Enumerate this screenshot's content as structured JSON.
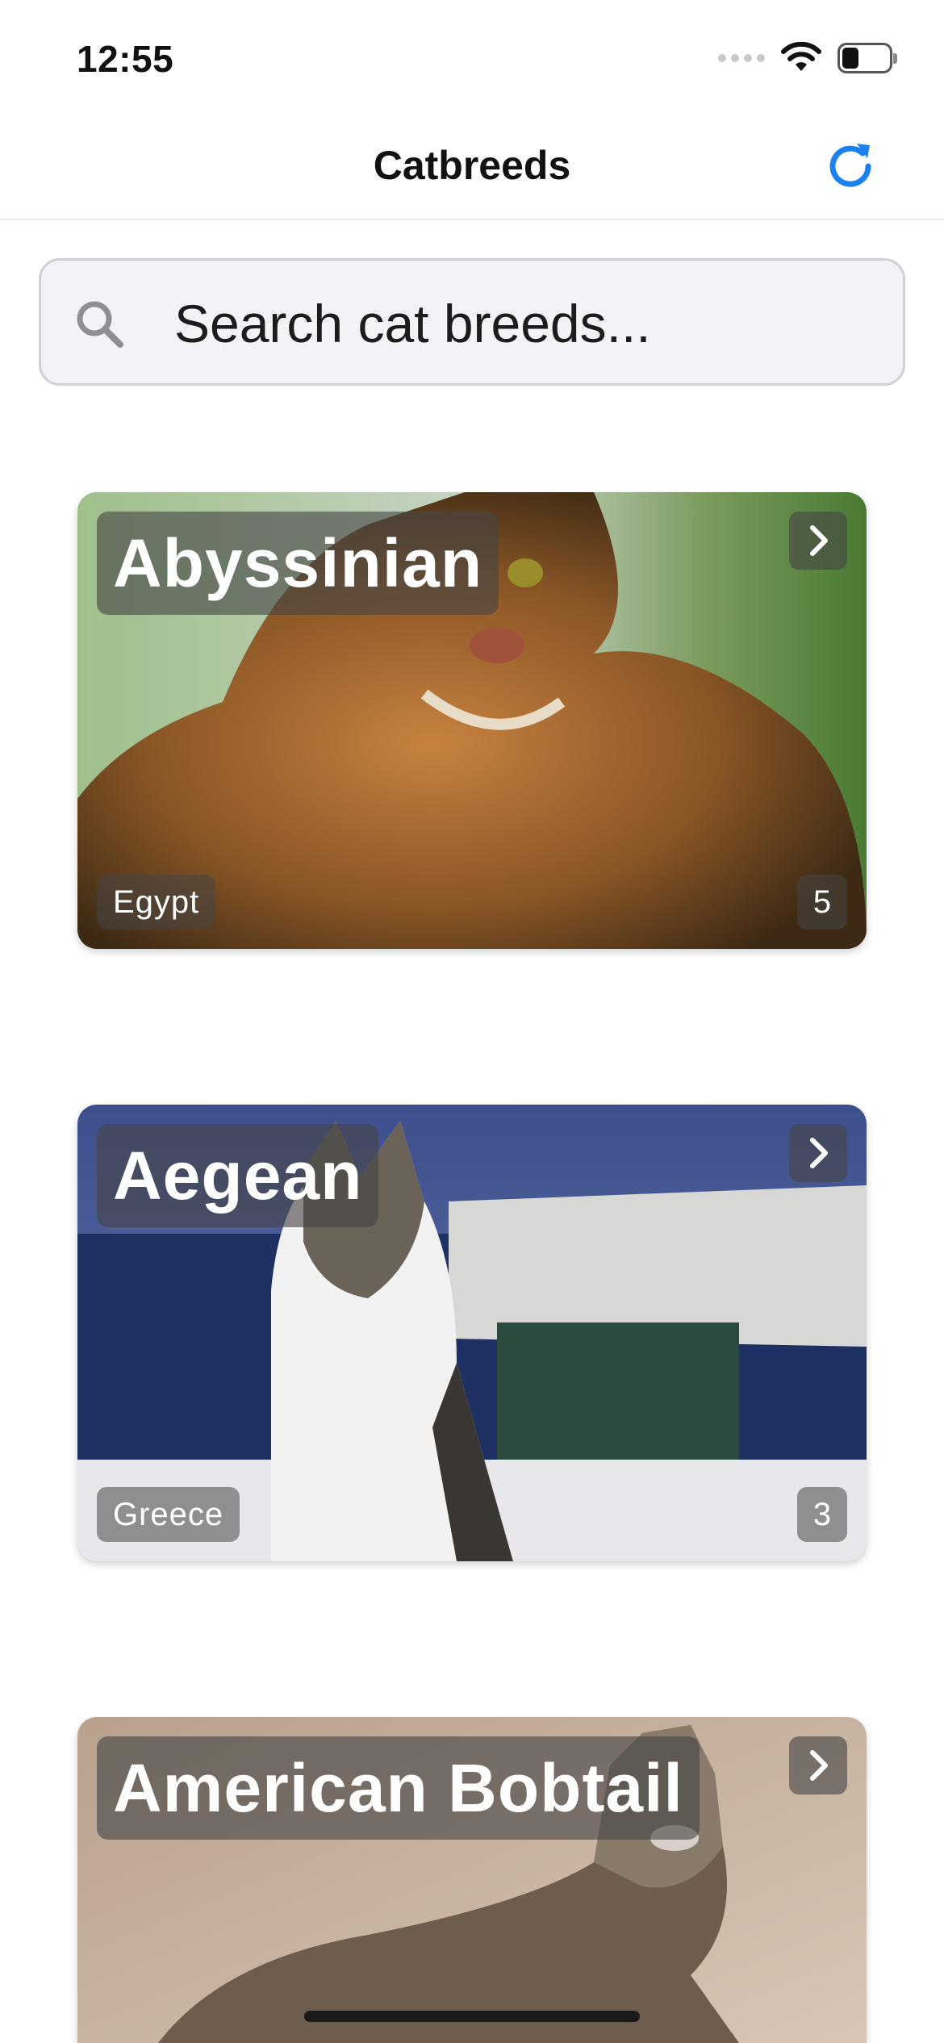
{
  "status_bar": {
    "time": "12:55"
  },
  "nav": {
    "title": "Catbreeds"
  },
  "search": {
    "placeholder": "Search cat breeds..."
  },
  "breeds": [
    {
      "name": "Abyssinian",
      "origin": "Egypt",
      "count": "5"
    },
    {
      "name": "Aegean",
      "origin": "Greece",
      "count": "3"
    },
    {
      "name": "American Bobtail",
      "origin": "",
      "count": ""
    }
  ],
  "colors": {
    "accent": "#1a82f0",
    "background": "#ffffff",
    "search_bg": "#f2f2f7"
  },
  "icons": {
    "refresh": "refresh-icon",
    "search": "search-icon",
    "chevron": "chevron-right-icon"
  }
}
